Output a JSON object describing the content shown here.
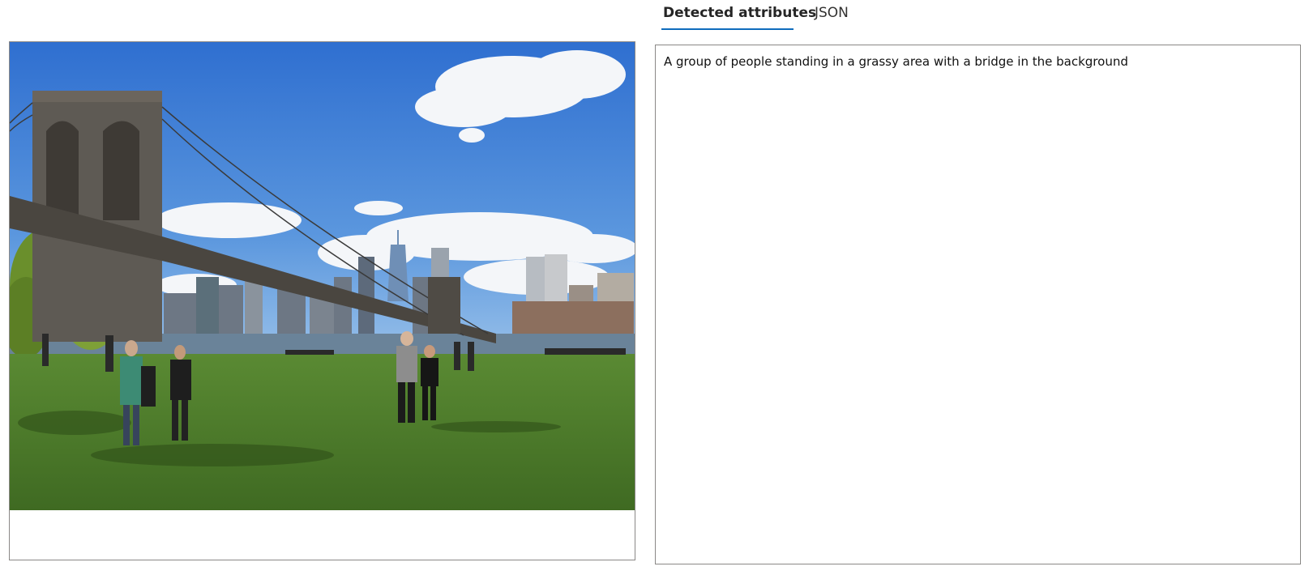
{
  "tabs": [
    {
      "label": "Detected attributes",
      "active": true
    },
    {
      "label": "JSON",
      "active": false
    }
  ],
  "image": {
    "alt": "A group of people standing in a grassy area with a bridge in the background"
  },
  "result": {
    "caption": "A group of people standing in a grassy area with a bridge in the background"
  },
  "colors": {
    "accent": "#0f6cbd",
    "border": "#8a8886",
    "sky": "#3d7fd6",
    "grass": "#4f7d2a"
  }
}
